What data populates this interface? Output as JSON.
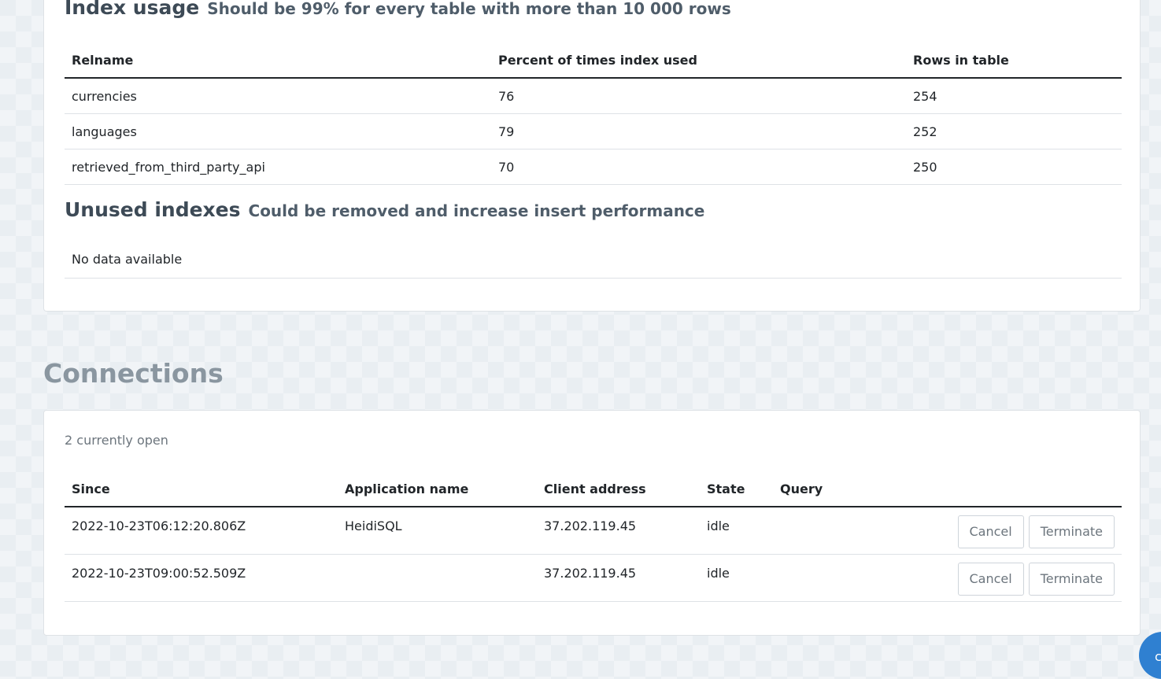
{
  "index_usage": {
    "title": "Index usage",
    "subtitle": "Should be 99% for every table with more than 10 000 rows",
    "columns": [
      "Relname",
      "Percent of times index used",
      "Rows in table"
    ],
    "rows": [
      [
        "currencies",
        "76",
        "254"
      ],
      [
        "languages",
        "79",
        "252"
      ],
      [
        "retrieved_from_third_party_api",
        "70",
        "250"
      ]
    ]
  },
  "unused_indexes": {
    "title": "Unused indexes",
    "subtitle": "Could be removed and increase insert performance",
    "empty_text": "No data available"
  },
  "connections": {
    "heading": "Connections",
    "open_count": "2 currently open",
    "columns": [
      "Since",
      "Application name",
      "Client address",
      "State",
      "Query"
    ],
    "rows": [
      {
        "since": "2022-10-23T06:12:20.806Z",
        "application_name": "HeidiSQL",
        "client_address": "37.202.119.45",
        "state": "idle",
        "query": "",
        "cancel_label": "Cancel",
        "terminate_label": "Terminate"
      },
      {
        "since": "2022-10-23T09:00:52.509Z",
        "application_name": "",
        "client_address": "37.202.119.45",
        "state": "idle",
        "query": "",
        "cancel_label": "Cancel",
        "terminate_label": "Terminate"
      }
    ]
  },
  "fab": {
    "icon": "chat-icon",
    "glyph": "c"
  },
  "colors": {
    "page_bg": "#e9eef2",
    "card_bg": "#ffffff",
    "text": "#212529",
    "muted": "#6c757d",
    "heading_muted": "#8a96a0",
    "fab": "#2f80d1"
  }
}
